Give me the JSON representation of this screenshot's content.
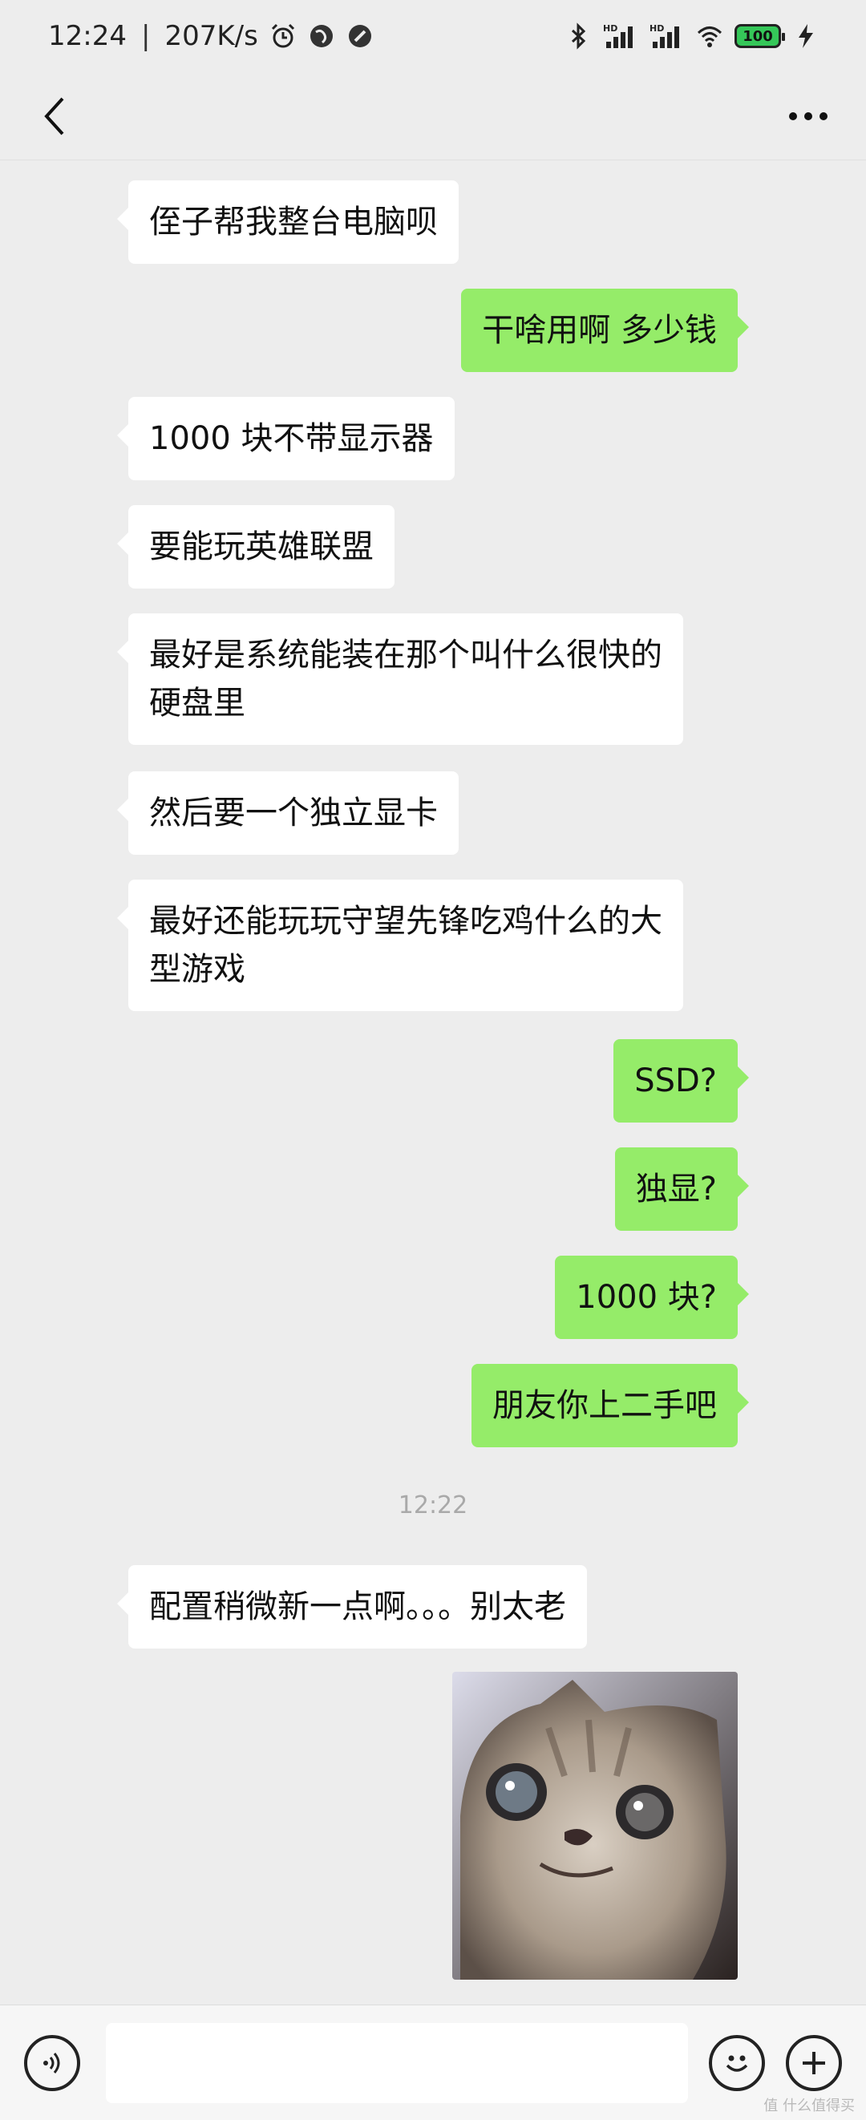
{
  "status_bar": {
    "time": "12:24",
    "separator": "|",
    "net_speed": "207K/s",
    "battery": "100"
  },
  "nav": {
    "back_icon": "chevron-left-icon",
    "more_icon": "more-dots-icon"
  },
  "messages": [
    {
      "side": "in",
      "text": "侄子帮我整台电脑呗"
    },
    {
      "side": "out",
      "text": "干啥用啊 多少钱"
    },
    {
      "side": "in",
      "text": "1000 块不带显示器"
    },
    {
      "side": "in",
      "text": "要能玩英雄联盟"
    },
    {
      "side": "in",
      "text": "最好是系统能装在那个叫什么很快的\n硬盘里"
    },
    {
      "side": "in",
      "text": "然后要一个独立显卡"
    },
    {
      "side": "in",
      "text": "最好还能玩玩守望先锋吃鸡什么的大\n型游戏"
    },
    {
      "side": "out",
      "text": "SSD?"
    },
    {
      "side": "out",
      "text": "独显?"
    },
    {
      "side": "out",
      "text": "1000 块?"
    },
    {
      "side": "out",
      "text": "朋友你上二手吧"
    },
    {
      "side": "in",
      "text": "配置稍微新一点啊。。。别太老"
    }
  ],
  "timestamp": "12:22",
  "image_message": {
    "icon": "cat-photo"
  },
  "input_bar": {
    "voice_icon": "voice-icon",
    "emoji_icon": "emoji-icon",
    "plus_icon": "plus-icon"
  },
  "watermark": "值 什么值得买"
}
